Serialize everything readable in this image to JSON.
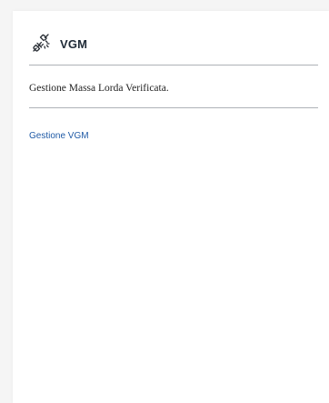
{
  "card": {
    "icon": "plug-disconnect-icon",
    "title": "VGM",
    "description": "Gestione Massa Lorda Verificata.",
    "link_label": "Gestione VGM"
  },
  "colors": {
    "title": "#1f2a37",
    "link": "#1f5aa6",
    "divider": "#aeb2b7"
  }
}
